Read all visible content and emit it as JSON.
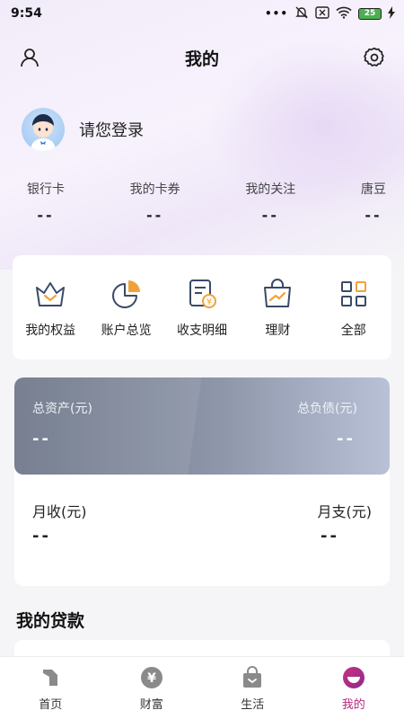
{
  "status_bar": {
    "time": "9:54",
    "battery": "25",
    "icons": [
      "dots-icon",
      "mute-icon",
      "sim-icon",
      "wifi-icon",
      "battery-icon",
      "charging-icon"
    ]
  },
  "header": {
    "title": "我的",
    "left_icon": "user-icon",
    "right_icon": "gear-icon"
  },
  "profile": {
    "login_text": "请您登录"
  },
  "stats": [
    {
      "label": "银行卡",
      "value": "--"
    },
    {
      "label": "我的卡券",
      "value": "--"
    },
    {
      "label": "我的关注",
      "value": "--"
    },
    {
      "label": "唐豆",
      "value": "--"
    }
  ],
  "quick_menu": [
    {
      "label": "我的权益",
      "icon": "crown-icon"
    },
    {
      "label": "账户总览",
      "icon": "pie-chart-icon"
    },
    {
      "label": "收支明细",
      "icon": "bill-icon"
    },
    {
      "label": "理财",
      "icon": "wealth-bag-icon"
    },
    {
      "label": "全部",
      "icon": "grid-icon"
    }
  ],
  "assets": {
    "total_assets_label": "总资产(元)",
    "total_assets_value": "--",
    "total_debt_label": "总负债(元)",
    "total_debt_value": "--",
    "monthly_income_label": "月收(元)",
    "monthly_income_value": "--",
    "monthly_expense_label": "月支(元)",
    "monthly_expense_value": "--"
  },
  "loans": {
    "title": "我的贷款"
  },
  "tabbar": [
    {
      "label": "首页",
      "icon": "home-icon",
      "active": false
    },
    {
      "label": "财富",
      "icon": "yuan-icon",
      "active": false
    },
    {
      "label": "生活",
      "icon": "shopping-bag-icon",
      "active": false
    },
    {
      "label": "我的",
      "icon": "profile-smile-icon",
      "active": true
    }
  ],
  "colors": {
    "accent": "#b7287d",
    "quick_icon": "#3a4a66",
    "quick_icon_highlight": "#f0a23a",
    "card_gradient_start": "#6d7689",
    "card_gradient_end": "#b8c1d6"
  }
}
